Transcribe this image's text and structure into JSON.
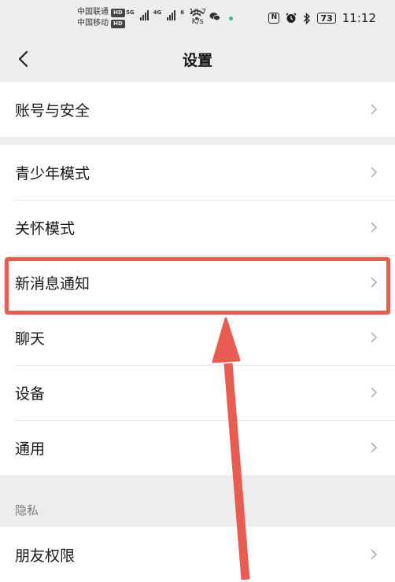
{
  "status_bar": {
    "carrier_1": "中国联通",
    "carrier_2": "中国移动",
    "hd_badge": "HD",
    "net_1": "5G",
    "net_2": "4G",
    "net_3": "6",
    "speed_value": "10.7",
    "speed_unit": "K/s",
    "battery": "73",
    "time": "11:12",
    "nfc_letter": "N"
  },
  "nav": {
    "title": "设置"
  },
  "groups": [
    {
      "items": [
        {
          "label": "账号与安全"
        }
      ]
    },
    {
      "items": [
        {
          "label": "青少年模式"
        },
        {
          "label": "关怀模式"
        },
        {
          "label": "新消息通知"
        },
        {
          "label": "聊天"
        },
        {
          "label": "设备"
        },
        {
          "label": "通用"
        }
      ]
    }
  ],
  "privacy_section": {
    "label": "隐私",
    "items": [
      {
        "label": "朋友权限"
      }
    ]
  },
  "colors": {
    "highlight": "#e85c52",
    "background": "#ededed",
    "card": "#ffffff"
  }
}
